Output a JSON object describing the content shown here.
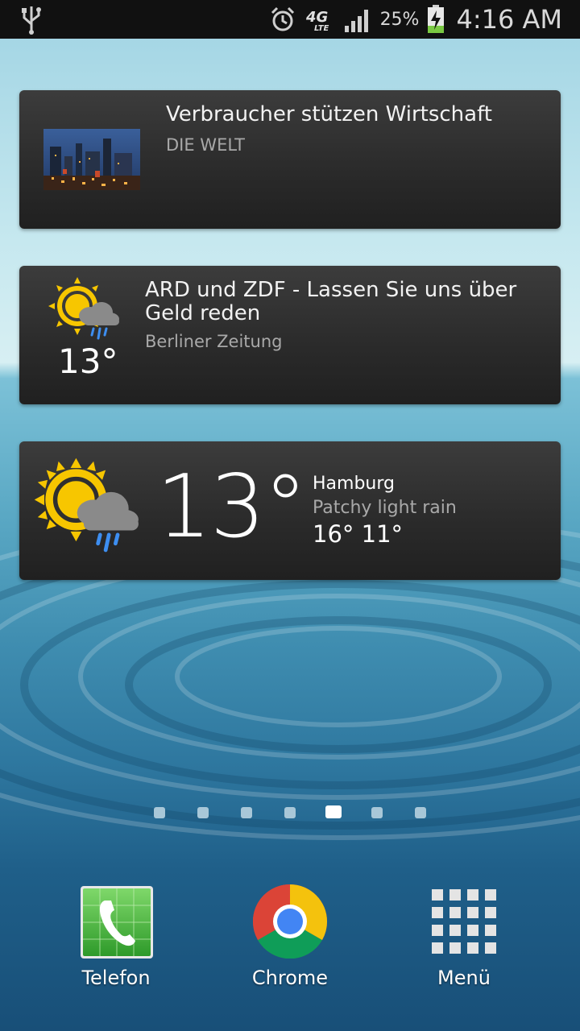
{
  "status_bar": {
    "battery_percent": "25%",
    "time": "4:16 AM",
    "network": "4G LTE",
    "icons": [
      "usb-icon",
      "alarm-icon",
      "4g-lte-icon",
      "signal-icon",
      "battery-charging-icon"
    ]
  },
  "news_widget_1": {
    "headline": "Verbraucher stützen Wirtschaft",
    "source": "DIE WELT"
  },
  "news_widget_2": {
    "headline": "ARD und ZDF - Lassen Sie uns über Geld reden",
    "source": "Berliner Zeitung",
    "temperature": "13°"
  },
  "weather_widget": {
    "temperature": "13°",
    "city": "Hamburg",
    "condition": "Patchy light rain",
    "high_low": "16° 11°"
  },
  "pager": {
    "total": 7,
    "active_index": 4
  },
  "dock": {
    "phone_label": "Telefon",
    "chrome_label": "Chrome",
    "menu_label": "Menü"
  },
  "colors": {
    "status_bar": "#111111",
    "card_bg": "#2a2a2a",
    "sun_yellow": "#f7c600",
    "rain_blue": "#3d8ef0"
  }
}
